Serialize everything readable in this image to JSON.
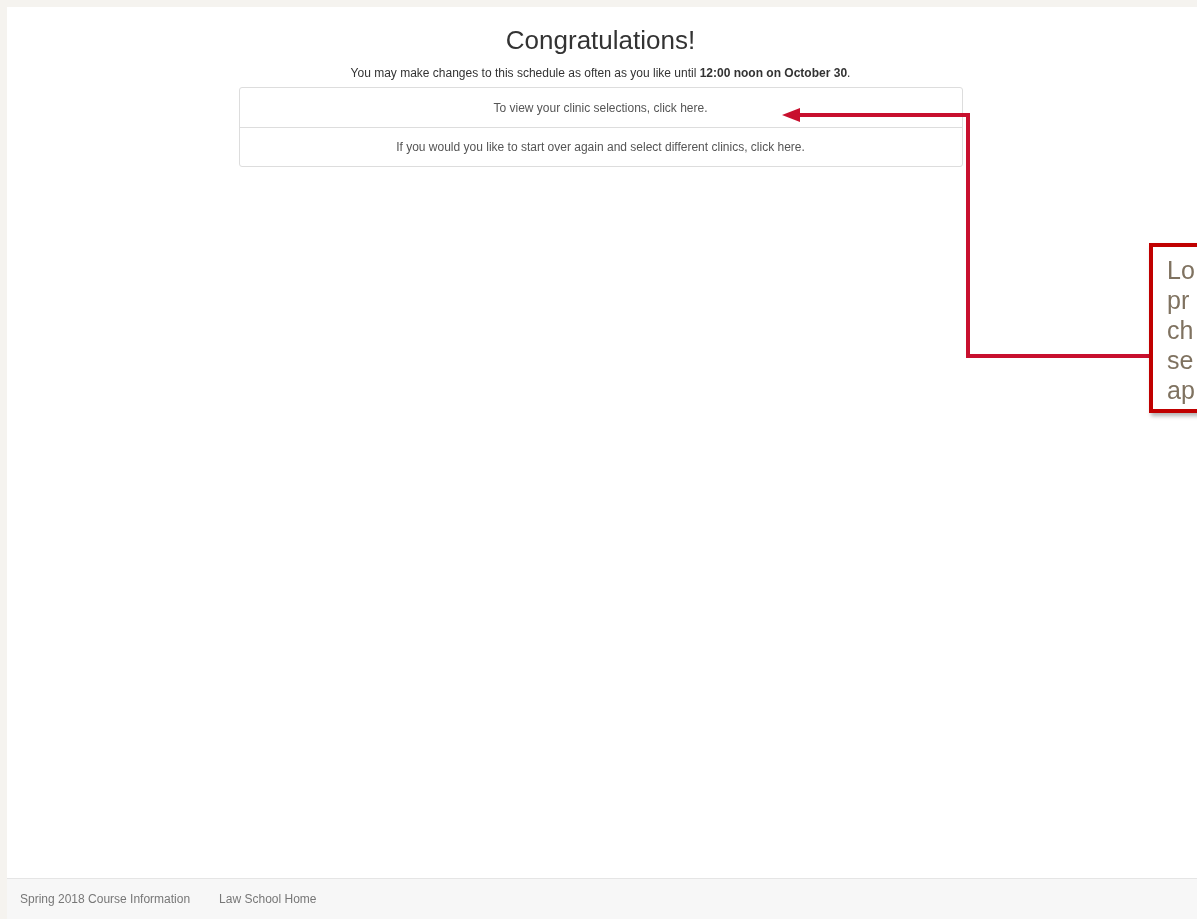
{
  "heading": "Congratulations!",
  "notice": "You may make changes to this schedule as often as you like until **12:00 noon on October 30**.",
  "links": [
    "To view your clinic selections, click here.",
    "If you would you like to start over again and select different clinics, click here."
  ],
  "callout": {
    "lines": [
      "Lo",
      "pr",
      "ch",
      "se",
      "ap"
    ]
  },
  "footer": {
    "links": [
      "Spring 2018 Course Information",
      "Law School Home"
    ]
  }
}
